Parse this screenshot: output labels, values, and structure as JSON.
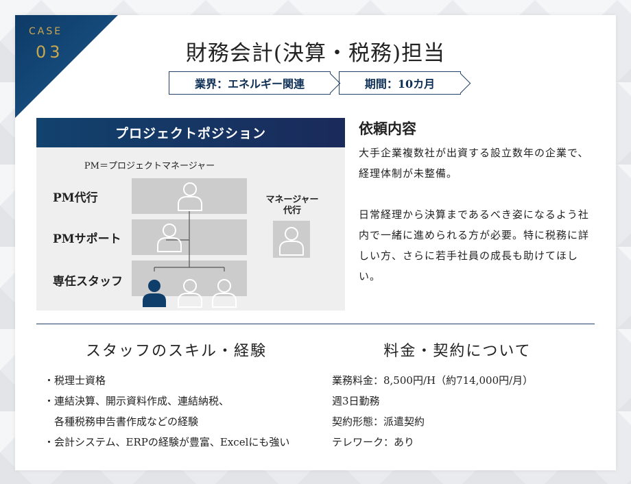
{
  "header": {
    "case_label": "CASE",
    "case_number": "03",
    "title": "財務会計(決算・税務)担当",
    "tag_industry": "業界：エネルギー関連",
    "tag_period": "期間：10カ月"
  },
  "position": {
    "heading": "プロジェクトポジション",
    "note": "PM＝プロジェクトマネージャー",
    "rows": [
      "PM代行",
      "PMサポート",
      "専任スタッフ"
    ],
    "manager_label_1": "マネージャー",
    "manager_label_2": "代行",
    "colors": {
      "highlight": "#0f3e6b",
      "placeholder": "#cccccc"
    }
  },
  "request": {
    "heading": "依頼内容",
    "p1": "大手企業複数社が出資する設立数年の企業で、経理体制が未整備。",
    "p2": "日常経理から決算まであるべき姿になるよう社内で一緒に進められる方が必要。特に税務に詳しい方、さらに若手社員の成長も助けてほしい。"
  },
  "skills": {
    "heading": "スタッフのスキル・経験",
    "items": [
      "・税理士資格",
      "・連結決算、開示資料作成、連結納税、",
      "　各種税務申告書作成などの経験",
      "・会計システム、ERPの経験が豊富、Excelにも強い"
    ]
  },
  "fee": {
    "heading": "料金・契約について",
    "items": [
      "業務料金：8,500円/H（約714,000円/月）",
      "週3日勤務",
      "契約形態：派遣契約",
      "テレワーク：あり"
    ]
  }
}
